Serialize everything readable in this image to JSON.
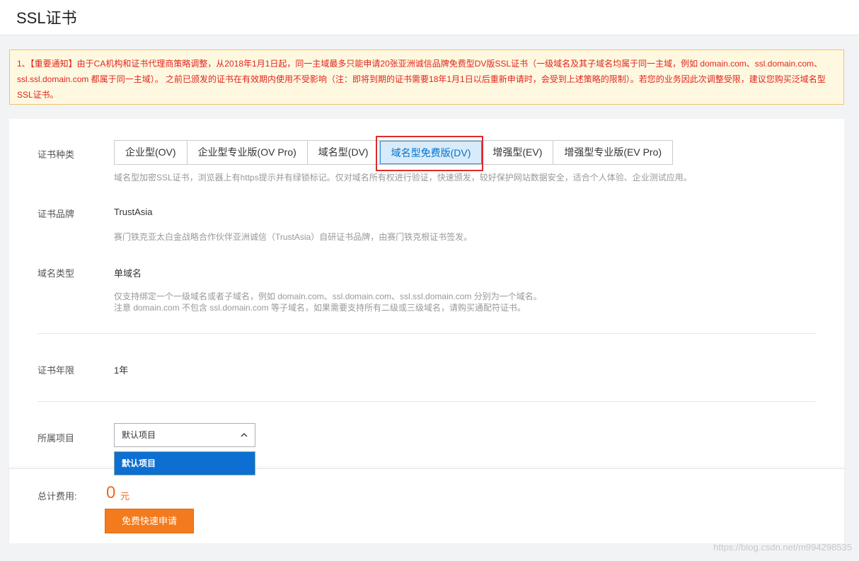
{
  "header": {
    "title": "SSL证书"
  },
  "notice": {
    "text": "1、【重要通知】由于CA机构和证书代理商策略调整，从2018年1月1日起，同一主域最多只能申请20张亚洲诚信品牌免费型DV版SSL证书（一级域名及其子域名均属于同一主域，例如 domain.com、ssl.domain.com、ssl.ssl.domain.com 都属于同一主域）。 之前已颁发的证书在有效期内使用不受影响（注：即将到期的证书需要18年1月1日以后重新申请时，会受到上述策略的限制）。若您的业务因此次调整受限，建议您购买泛域名型SSL证书。"
  },
  "cert_type": {
    "label": "证书种类",
    "tabs": [
      {
        "label": "企业型(OV)"
      },
      {
        "label": "企业型专业版(OV Pro)"
      },
      {
        "label": "域名型(DV)"
      },
      {
        "label": "域名型免费版(DV)"
      },
      {
        "label": "增强型(EV)"
      },
      {
        "label": "增强型专业版(EV Pro)"
      }
    ],
    "active_index": 3,
    "desc": "域名型加密SSL证书，浏览器上有https提示并有绿锁标记。仅对域名所有权进行验证，快速颁发，较好保护网站数据安全，适合个人体验、企业测试应用。"
  },
  "brand": {
    "label": "证书品牌",
    "value": "TrustAsia",
    "desc": "赛门铁克亚太白金战略合作伙伴亚洲诚信（TrustAsia）自研证书品牌，由赛门铁克根证书签发。"
  },
  "domain_type": {
    "label": "域名类型",
    "value": "单域名",
    "desc_line1": "仅支持绑定一个一级域名或者子域名，例如 domain.com、ssl.domain.com、ssl.ssl.domain.com 分别为一个域名。",
    "desc_line2": "注意 domain.com 不包含 ssl.domain.com 等子域名，如果需要支持所有二级或三级域名，请购买通配符证书。"
  },
  "years": {
    "label": "证书年限",
    "value": "1年"
  },
  "project": {
    "label": "所属项目",
    "selected": "默认项目",
    "options": [
      "默认项目"
    ]
  },
  "footer": {
    "total_label": "总计费用:",
    "total_value": "0",
    "unit": "元",
    "apply_label": "免费快速申请"
  },
  "watermark": "https://blog.csdn.net/m994298535",
  "colors": {
    "accent": "#f37b1d",
    "active_tab": "#d7ebfa",
    "notice_text": "#e0261c"
  }
}
